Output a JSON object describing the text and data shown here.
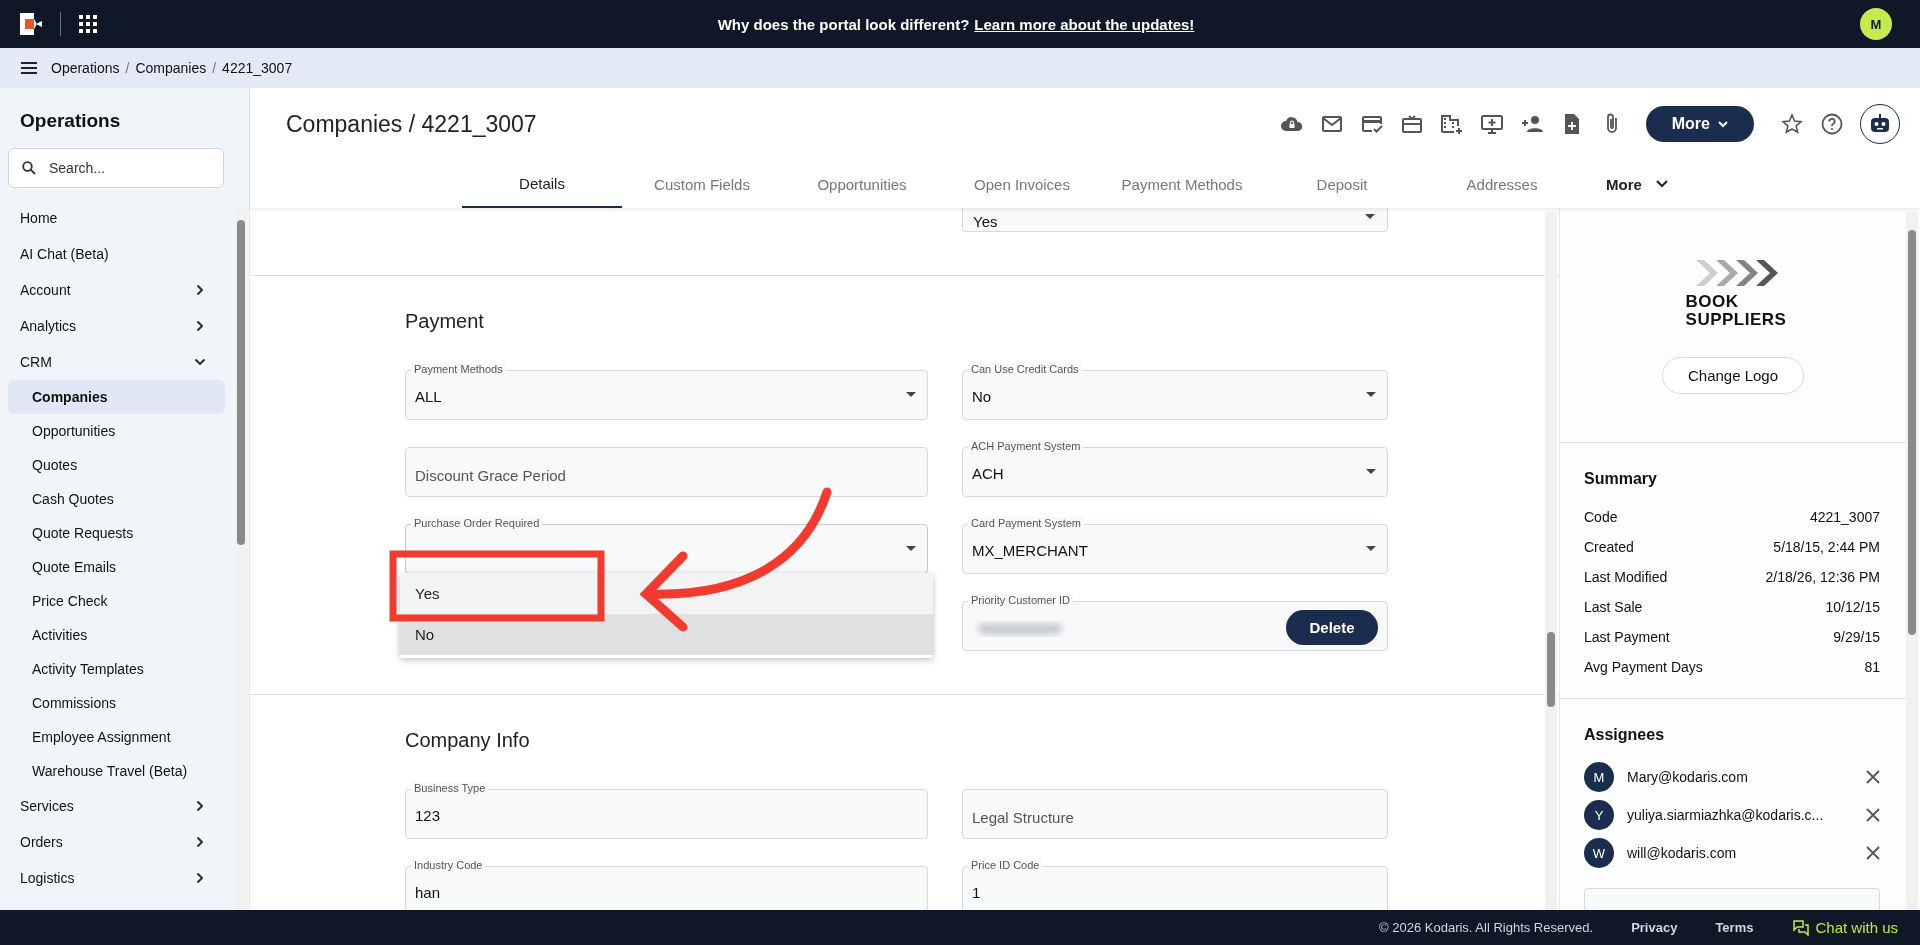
{
  "banner": {
    "text": "Why does the portal look different?",
    "link": "Learn more about the updates!"
  },
  "user": {
    "initial": "M"
  },
  "breadcrumb": {
    "separator": "/",
    "items": [
      "Operations",
      "Companies",
      "4221_3007"
    ]
  },
  "sidebar": {
    "title": "Operations",
    "search": {
      "placeholder": "Search..."
    },
    "items": [
      {
        "label": "Home",
        "selected": false
      },
      {
        "label": "AI Chat (Beta)",
        "selected": false
      },
      {
        "label": "Account",
        "selected": false,
        "expanded": false
      },
      {
        "label": "Analytics",
        "selected": false,
        "expanded": false
      },
      {
        "label": "CRM",
        "selected": false,
        "expanded": true,
        "children": [
          {
            "label": "Companies",
            "selected": true
          },
          {
            "label": "Opportunities",
            "selected": false
          },
          {
            "label": "Quotes",
            "selected": false
          },
          {
            "label": "Cash Quotes",
            "selected": false
          },
          {
            "label": "Quote Requests",
            "selected": false
          },
          {
            "label": "Quote Emails",
            "selected": false
          },
          {
            "label": "Price Check",
            "selected": false
          },
          {
            "label": "Activities",
            "selected": false
          },
          {
            "label": "Activity Templates",
            "selected": false
          },
          {
            "label": "Commissions",
            "selected": false
          },
          {
            "label": "Employee Assignment",
            "selected": false
          },
          {
            "label": "Warehouse Travel (Beta)",
            "selected": false
          }
        ]
      },
      {
        "label": "Services",
        "selected": false,
        "expanded": false
      },
      {
        "label": "Orders",
        "selected": false,
        "expanded": false
      },
      {
        "label": "Logistics",
        "selected": false,
        "expanded": false
      }
    ]
  },
  "page": {
    "title": "Companies / 4221_3007",
    "more_button": "More"
  },
  "tabs": [
    {
      "label": "Details",
      "selected": true
    },
    {
      "label": "Custom Fields",
      "selected": false
    },
    {
      "label": "Opportunities",
      "selected": false
    },
    {
      "label": "Open Invoices",
      "selected": false
    },
    {
      "label": "Payment Methods",
      "selected": false
    },
    {
      "label": "Deposit",
      "selected": false
    },
    {
      "label": "Addresses",
      "selected": false
    },
    {
      "label": "More",
      "selected": false,
      "kind": "menu"
    }
  ],
  "top_field": {
    "kind": "select",
    "value": "Yes"
  },
  "sections": [
    {
      "title": "Payment",
      "columns": [
        [
          {
            "kind": "select",
            "label": "Payment Methods",
            "value": "ALL"
          },
          {
            "kind": "text",
            "placeholder": "Discount Grace Period"
          },
          {
            "kind": "select",
            "label": "Purchase Order Required",
            "open": true,
            "options": [
              {
                "label": "Yes",
                "selected": true,
                "hovered": false
              },
              {
                "label": "No",
                "selected": false,
                "hovered": true
              }
            ]
          }
        ],
        [
          {
            "kind": "select",
            "label": "Can Use Credit Cards",
            "value": "No"
          },
          {
            "kind": "select",
            "label": "ACH Payment System",
            "value": "ACH"
          },
          {
            "kind": "select",
            "label": "Card Payment System",
            "value": "MX_MERCHANT"
          },
          {
            "kind": "redacted",
            "label": "Priority Customer ID",
            "button": "Delete"
          }
        ]
      ]
    },
    {
      "title": "Company Info",
      "columns": [
        [
          {
            "kind": "text",
            "label": "Business Type",
            "value": "123"
          },
          {
            "kind": "text",
            "label": "Industry Code",
            "value": "han"
          }
        ],
        [
          {
            "kind": "text",
            "placeholder": "Legal Structure"
          },
          {
            "kind": "text",
            "label": "Price ID Code",
            "value": "1"
          }
        ]
      ]
    }
  ],
  "logo": {
    "line_1": "BOOK",
    "line_2": "SUPPLIERS"
  },
  "change_logo": "Change Logo",
  "summary": {
    "title": "Summary",
    "rows": [
      {
        "label": "Code",
        "value": "4221_3007"
      },
      {
        "label": "Created",
        "value": "5/18/15, 2:44 PM"
      },
      {
        "label": "Last Modified",
        "value": "2/18/26, 12:36 PM"
      },
      {
        "label": "Last Sale",
        "value": "10/12/15"
      },
      {
        "label": "Last Payment",
        "value": "9/29/15"
      },
      {
        "label": "Avg Payment Days",
        "value": "81"
      }
    ]
  },
  "assignees": {
    "title": "Assignees",
    "items": [
      {
        "initial": "M",
        "email": "Mary@kodaris.com"
      },
      {
        "initial": "Y",
        "email": "yuliya.siarmiazhka@kodaris.c..."
      },
      {
        "initial": "W",
        "email": "will@kodaris.com"
      }
    ]
  },
  "footer": {
    "copyright": "© 2026 Kodaris. All Rights Reserved.",
    "links": [
      "Privacy",
      "Terms"
    ],
    "chat": "Chat with us"
  }
}
